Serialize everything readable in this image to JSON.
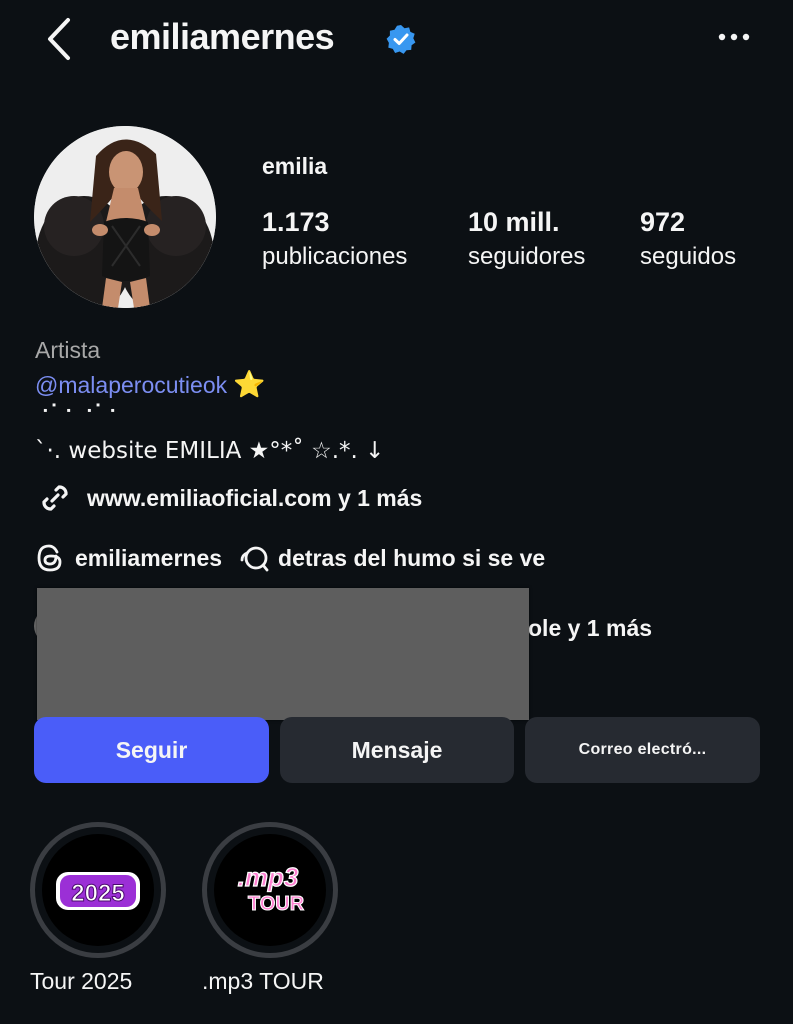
{
  "header": {
    "username": "emiliamernes",
    "back_icon": "chevron-left-icon",
    "verified_icon": "verified-badge-icon",
    "more_icon": "more-horizontal-icon"
  },
  "profile": {
    "display_name": "emilia",
    "stats": [
      {
        "value": "1.173",
        "label": "publicaciones"
      },
      {
        "value": "10 mill.",
        "label": "seguidores"
      },
      {
        "value": "972",
        "label": "seguidos"
      }
    ]
  },
  "bio": {
    "category": "Artista",
    "mention": "@malaperocutieok",
    "mention_emoji": "⭐",
    "line1": "⠐⠁⠂⠐⠁⠂",
    "line2": "`·. website EMILIA ★°*˚ ☆.*. ↓",
    "link": "www.emiliaoficial.com y 1 más",
    "threads_handle": "emiliamernes",
    "threads_note": "detras del humo si se ve",
    "followed_by_suffix": "ole",
    "followed_by_more": "y 1 más"
  },
  "actions": {
    "follow": "Seguir",
    "message": "Mensaje",
    "email": "Correo electró..."
  },
  "highlights": [
    {
      "label": "Tour 2025",
      "cover_text": "2025"
    },
    {
      "label": ".mp3 TOUR",
      "cover_text_top": ".mp3",
      "cover_text_bottom": "TOUR"
    }
  ],
  "colors": {
    "background": "#0c1014",
    "accent": "#4a5df9",
    "mention": "#7c8ef2",
    "verified": "#3897f0",
    "secondary_button": "#262a31"
  }
}
